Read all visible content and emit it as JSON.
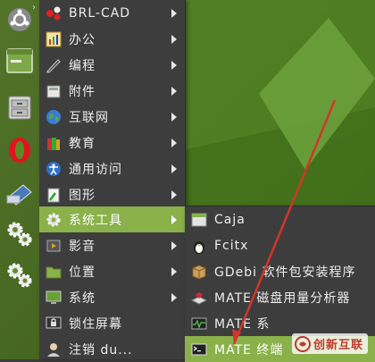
{
  "menu": {
    "items": [
      {
        "label": "BRL-CAD",
        "icon": "brlcad-icon"
      },
      {
        "label": "办公",
        "icon": "office-icon"
      },
      {
        "label": "编程",
        "icon": "programming-icon"
      },
      {
        "label": "附件",
        "icon": "accessories-icon"
      },
      {
        "label": "互联网",
        "icon": "internet-globe-icon"
      },
      {
        "label": "教育",
        "icon": "education-icon"
      },
      {
        "label": "通用访问",
        "icon": "accessibility-icon"
      },
      {
        "label": "图形",
        "icon": "graphics-icon"
      },
      {
        "label": "系统工具",
        "icon": "system-tools-gear-icon"
      },
      {
        "label": "影音",
        "icon": "multimedia-icon"
      },
      {
        "label": "位置",
        "icon": "places-folder-icon"
      },
      {
        "label": "系统",
        "icon": "system-monitor-icon"
      },
      {
        "label": "锁住屏幕",
        "icon": "lock-screen-icon"
      },
      {
        "label": "注销 du...",
        "icon": "logout-user-icon"
      }
    ]
  },
  "submenu": {
    "items": [
      {
        "label": "Caja",
        "icon": "caja-file-manager-icon"
      },
      {
        "label": "Fcitx",
        "icon": "fcitx-penguin-icon"
      },
      {
        "label": "GDebi 软件包安装程序",
        "icon": "gdebi-package-icon"
      },
      {
        "label": "MATE 磁盘用量分析器",
        "icon": "disk-usage-icon"
      },
      {
        "label": "MATE 系",
        "icon": "system-monitor-graph-icon"
      },
      {
        "label": "MATE 终端",
        "icon": "terminal-icon"
      }
    ]
  },
  "dock": {
    "items": [
      "ubuntu-logo-icon",
      "window-list-icon",
      "file-cabinet-icon",
      "opera-browser-icon",
      "scanner-icon",
      "settings-gears-icon",
      "settings-gears-icon"
    ]
  },
  "watermark": {
    "text": "创新互联"
  },
  "colors": {
    "accent": "#8ab14a",
    "menu_bg": "#3d3d3d",
    "annotation": "#d0362a"
  }
}
